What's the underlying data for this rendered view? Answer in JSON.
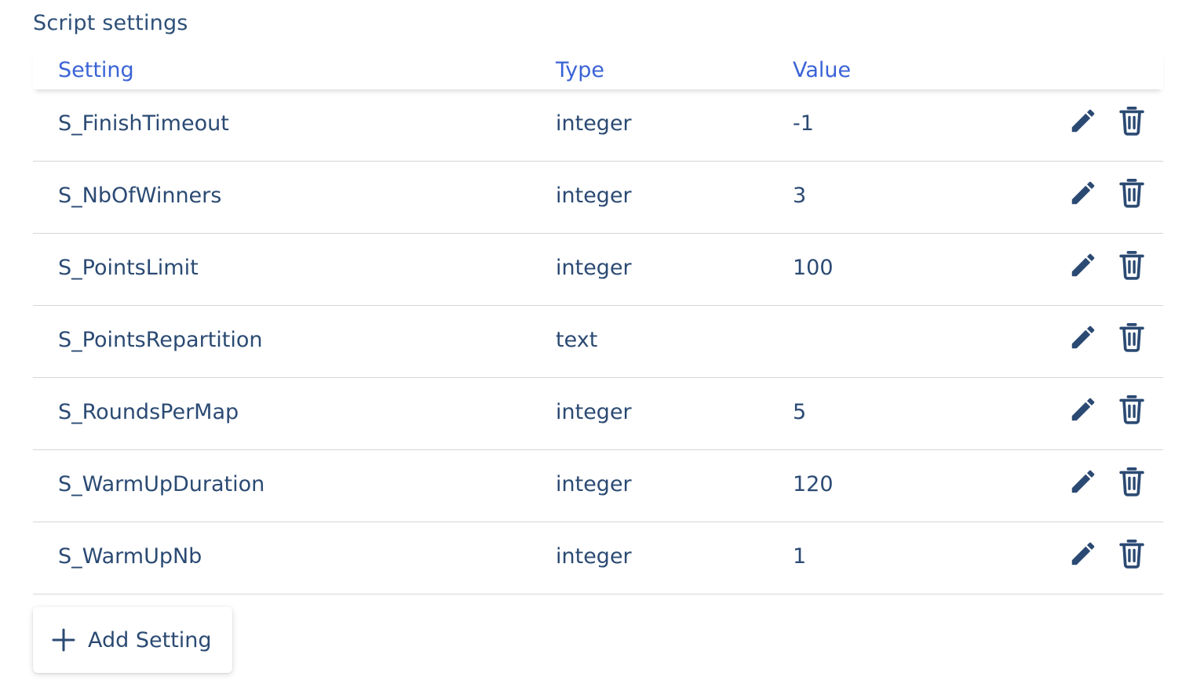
{
  "section": {
    "title": "Script settings"
  },
  "table": {
    "headers": {
      "setting": "Setting",
      "type": "Type",
      "value": "Value"
    },
    "rows": [
      {
        "setting": "S_FinishTimeout",
        "type": "integer",
        "value": "-1"
      },
      {
        "setting": "S_NbOfWinners",
        "type": "integer",
        "value": "3"
      },
      {
        "setting": "S_PointsLimit",
        "type": "integer",
        "value": "100"
      },
      {
        "setting": "S_PointsRepartition",
        "type": "text",
        "value": ""
      },
      {
        "setting": "S_RoundsPerMap",
        "type": "integer",
        "value": "5"
      },
      {
        "setting": "S_WarmUpDuration",
        "type": "integer",
        "value": "120"
      },
      {
        "setting": "S_WarmUpNb",
        "type": "integer",
        "value": "1"
      }
    ],
    "row_icons": [
      "pencil-icon",
      "trash-icon"
    ]
  },
  "add_button": {
    "label": "Add Setting",
    "icon": "plus-icon"
  },
  "colors": {
    "header_text": "#3a63d6",
    "body_text": "#2b4a73",
    "icon": "#2b4a73",
    "divider": "#d6d6d6"
  }
}
